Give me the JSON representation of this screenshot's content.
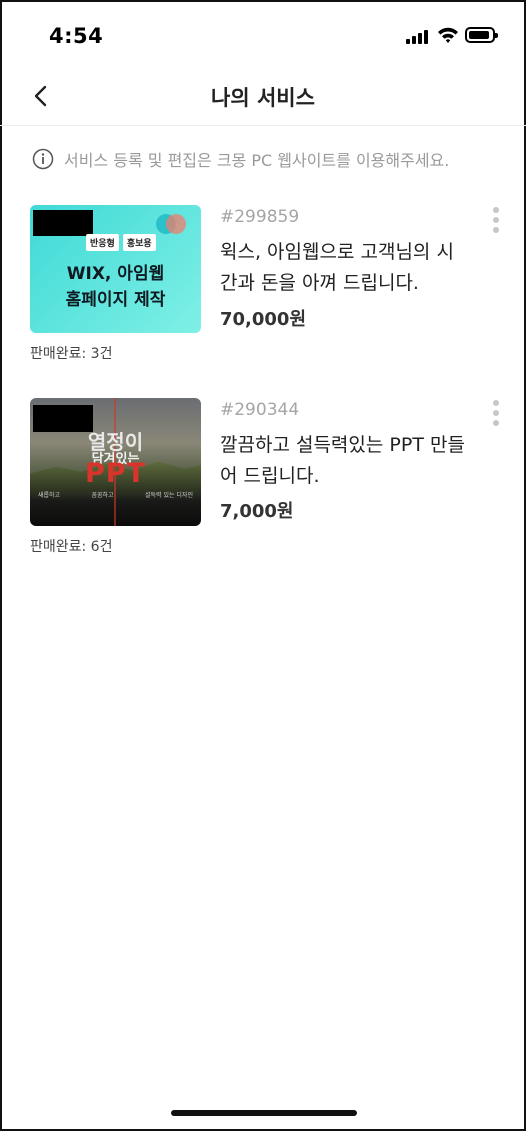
{
  "status_bar": {
    "time": "4:54"
  },
  "header": {
    "title": "나의 서비스",
    "back_icon": "chevron-left-icon"
  },
  "notice": {
    "text": "서비스 등록 및 편집은 크몽 PC 웹사이트를 이용해주세요.",
    "icon": "info-icon"
  },
  "services": [
    {
      "number": "#299859",
      "title": "윅스, 아임웹으로 고객님의 시간과 돈을 아껴 드립니다.",
      "price": "70,000원",
      "sold": "판매완료: 3건",
      "thumb": {
        "tags": [
          "반응형",
          "홍보용"
        ],
        "line1": "WIX, 아임웹",
        "line2": "홈페이지 제작"
      }
    },
    {
      "number": "#290344",
      "title": "깔끔하고 설득력있는 PPT 만들어 드립니다.",
      "price": "7,000원",
      "sold": "판매완료: 6건",
      "thumb": {
        "line1": "열정이",
        "line2": "담겨있는",
        "line3": "PPT",
        "sub": [
          "새롭하고",
          "꼼꼼하고",
          "설득력 있는 디자인"
        ]
      }
    }
  ],
  "colors": {
    "accent_mint": "#3fd9d6",
    "ppt_red": "#d9342b",
    "muted_text": "#9a9a9a"
  }
}
